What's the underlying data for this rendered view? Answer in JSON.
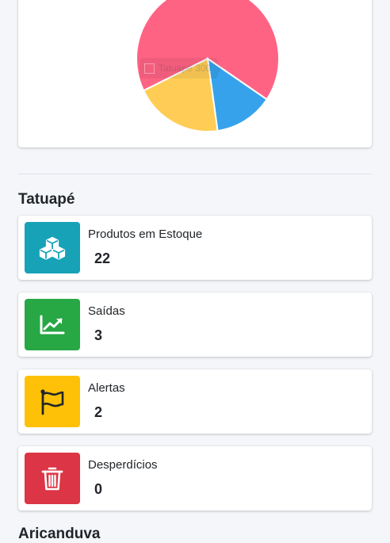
{
  "chart_data": {
    "type": "pie",
    "slices": [
      {
        "label": "Tatuapé",
        "value": 300,
        "color": "#ff6384"
      },
      {
        "label": "",
        "value": 60,
        "color": "#36a2eb"
      },
      {
        "label": "",
        "value": 90,
        "color": "#ffcd56"
      }
    ],
    "tooltip": {
      "label": "Tatuapé",
      "value": "300"
    }
  },
  "sections": [
    {
      "title": "Tatuapé",
      "boxes": [
        {
          "label": "Produtos em Estoque",
          "value": "22",
          "icon": "cubes-icon",
          "color": "#17a2b8"
        },
        {
          "label": "Saídas",
          "value": "3",
          "icon": "chart-line-icon",
          "color": "#28a745"
        },
        {
          "label": "Alertas",
          "value": "2",
          "icon": "flag-icon",
          "color": "#ffc107"
        },
        {
          "label": "Desperdícios",
          "value": "0",
          "icon": "trash-icon",
          "color": "#dc3545"
        }
      ]
    },
    {
      "title": "Aricanduva"
    }
  ]
}
